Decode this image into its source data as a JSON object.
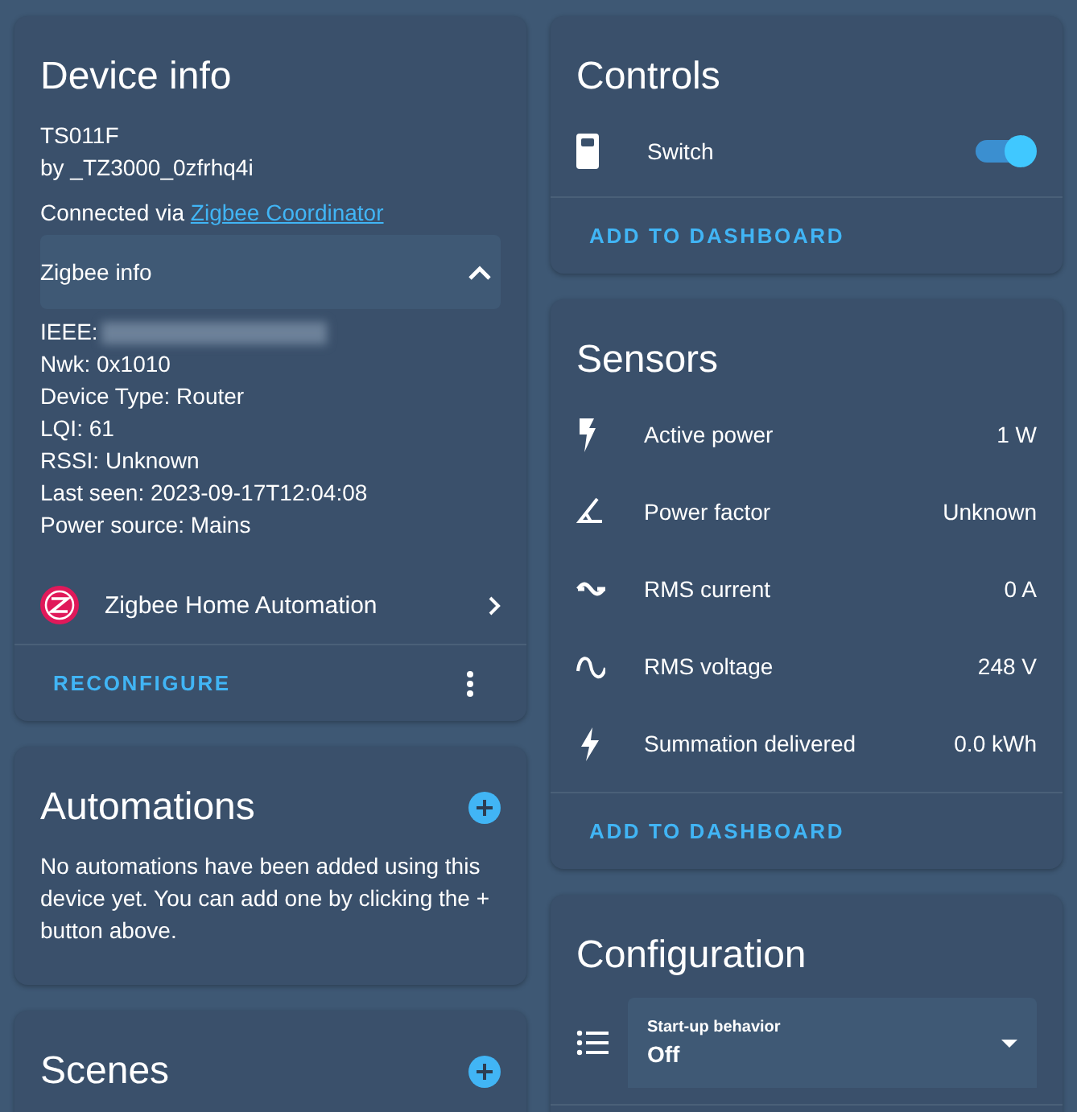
{
  "device_info": {
    "title": "Device info",
    "model": "TS011F",
    "manufacturer": "by _TZ3000_0zfrhq4i",
    "connected_via_label": "Connected via",
    "connected_via_link": "Zigbee Coordinator",
    "zigbee_info": {
      "title": "Zigbee info",
      "expanded": true,
      "lines": [
        "IEEE:",
        "Nwk: 0x1010",
        "Device Type: Router",
        "LQI: 61",
        "RSSI: Unknown",
        "Last seen: 2023-09-17T12:04:08",
        "Power source: Mains"
      ]
    },
    "integration": {
      "name": "Zigbee Home Automation"
    },
    "action": "RECONFIGURE"
  },
  "automations": {
    "title": "Automations",
    "empty_text": "No automations have been added using this device yet. You can add one by clicking the + button above."
  },
  "scenes": {
    "title": "Scenes"
  },
  "controls": {
    "title": "Controls",
    "entities": [
      {
        "name": "Switch",
        "on": true
      }
    ],
    "action": "ADD TO DASHBOARD"
  },
  "sensors": {
    "title": "Sensors",
    "entities": [
      {
        "name": "Active power",
        "value": "1 W",
        "kind": "power"
      },
      {
        "name": "Power factor",
        "value": "Unknown",
        "kind": "angle"
      },
      {
        "name": "RMS current",
        "value": "0 A",
        "kind": "current"
      },
      {
        "name": "RMS voltage",
        "value": "248 V",
        "kind": "voltage"
      },
      {
        "name": "Summation delivered",
        "value": "0.0 kWh",
        "kind": "energy"
      }
    ],
    "action": "ADD TO DASHBOARD"
  },
  "configuration": {
    "title": "Configuration",
    "select": {
      "label": "Start-up behavior",
      "value": "Off"
    }
  }
}
